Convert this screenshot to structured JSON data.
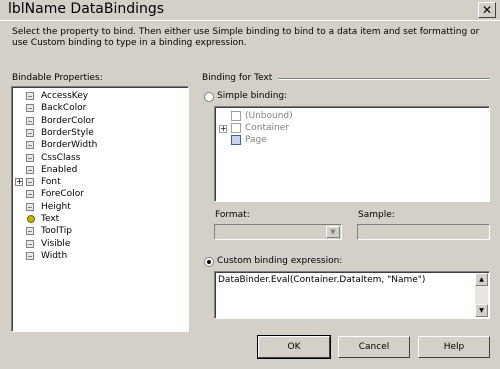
{
  "window": {
    "title": "lblName DataBindings"
  },
  "description": "Select the property to bind. Then either use Simple binding to bind to a data item and set formatting or use Custom binding to type in a binding expression.",
  "bindable_properties": {
    "label": "Bindable Properties:",
    "items": [
      {
        "label": "AccessKey",
        "icon": "property-icon"
      },
      {
        "label": "BackColor",
        "icon": "property-icon"
      },
      {
        "label": "BorderColor",
        "icon": "property-icon"
      },
      {
        "label": "BorderStyle",
        "icon": "property-icon"
      },
      {
        "label": "BorderWidth",
        "icon": "property-icon"
      },
      {
        "label": "CssClass",
        "icon": "property-icon"
      },
      {
        "label": "Enabled",
        "icon": "property-icon"
      },
      {
        "label": "Font",
        "icon": "property-icon",
        "expandable": true
      },
      {
        "label": "ForeColor",
        "icon": "property-icon"
      },
      {
        "label": "Height",
        "icon": "property-icon"
      },
      {
        "label": "Text",
        "icon": "lightbulb-icon",
        "bound": true
      },
      {
        "label": "ToolTip",
        "icon": "property-icon"
      },
      {
        "label": "Visible",
        "icon": "property-icon"
      },
      {
        "label": "Width",
        "icon": "property-icon"
      }
    ]
  },
  "binding_for": {
    "label": "Binding for Text"
  },
  "simple_binding": {
    "label": "Simple binding:",
    "selected": false,
    "tree": [
      {
        "label": "(Unbound)"
      },
      {
        "label": "Container",
        "expandable": true
      },
      {
        "label": "Page"
      }
    ]
  },
  "format": {
    "label": "Format:",
    "value": ""
  },
  "sample": {
    "label": "Sample:",
    "value": ""
  },
  "custom_binding": {
    "label": "Custom binding expression:",
    "selected": true,
    "expression": "DataBinder.Eval(Container.DataItem, \"Name\")"
  },
  "buttons": {
    "ok": "OK",
    "cancel": "Cancel",
    "help": "Help"
  }
}
